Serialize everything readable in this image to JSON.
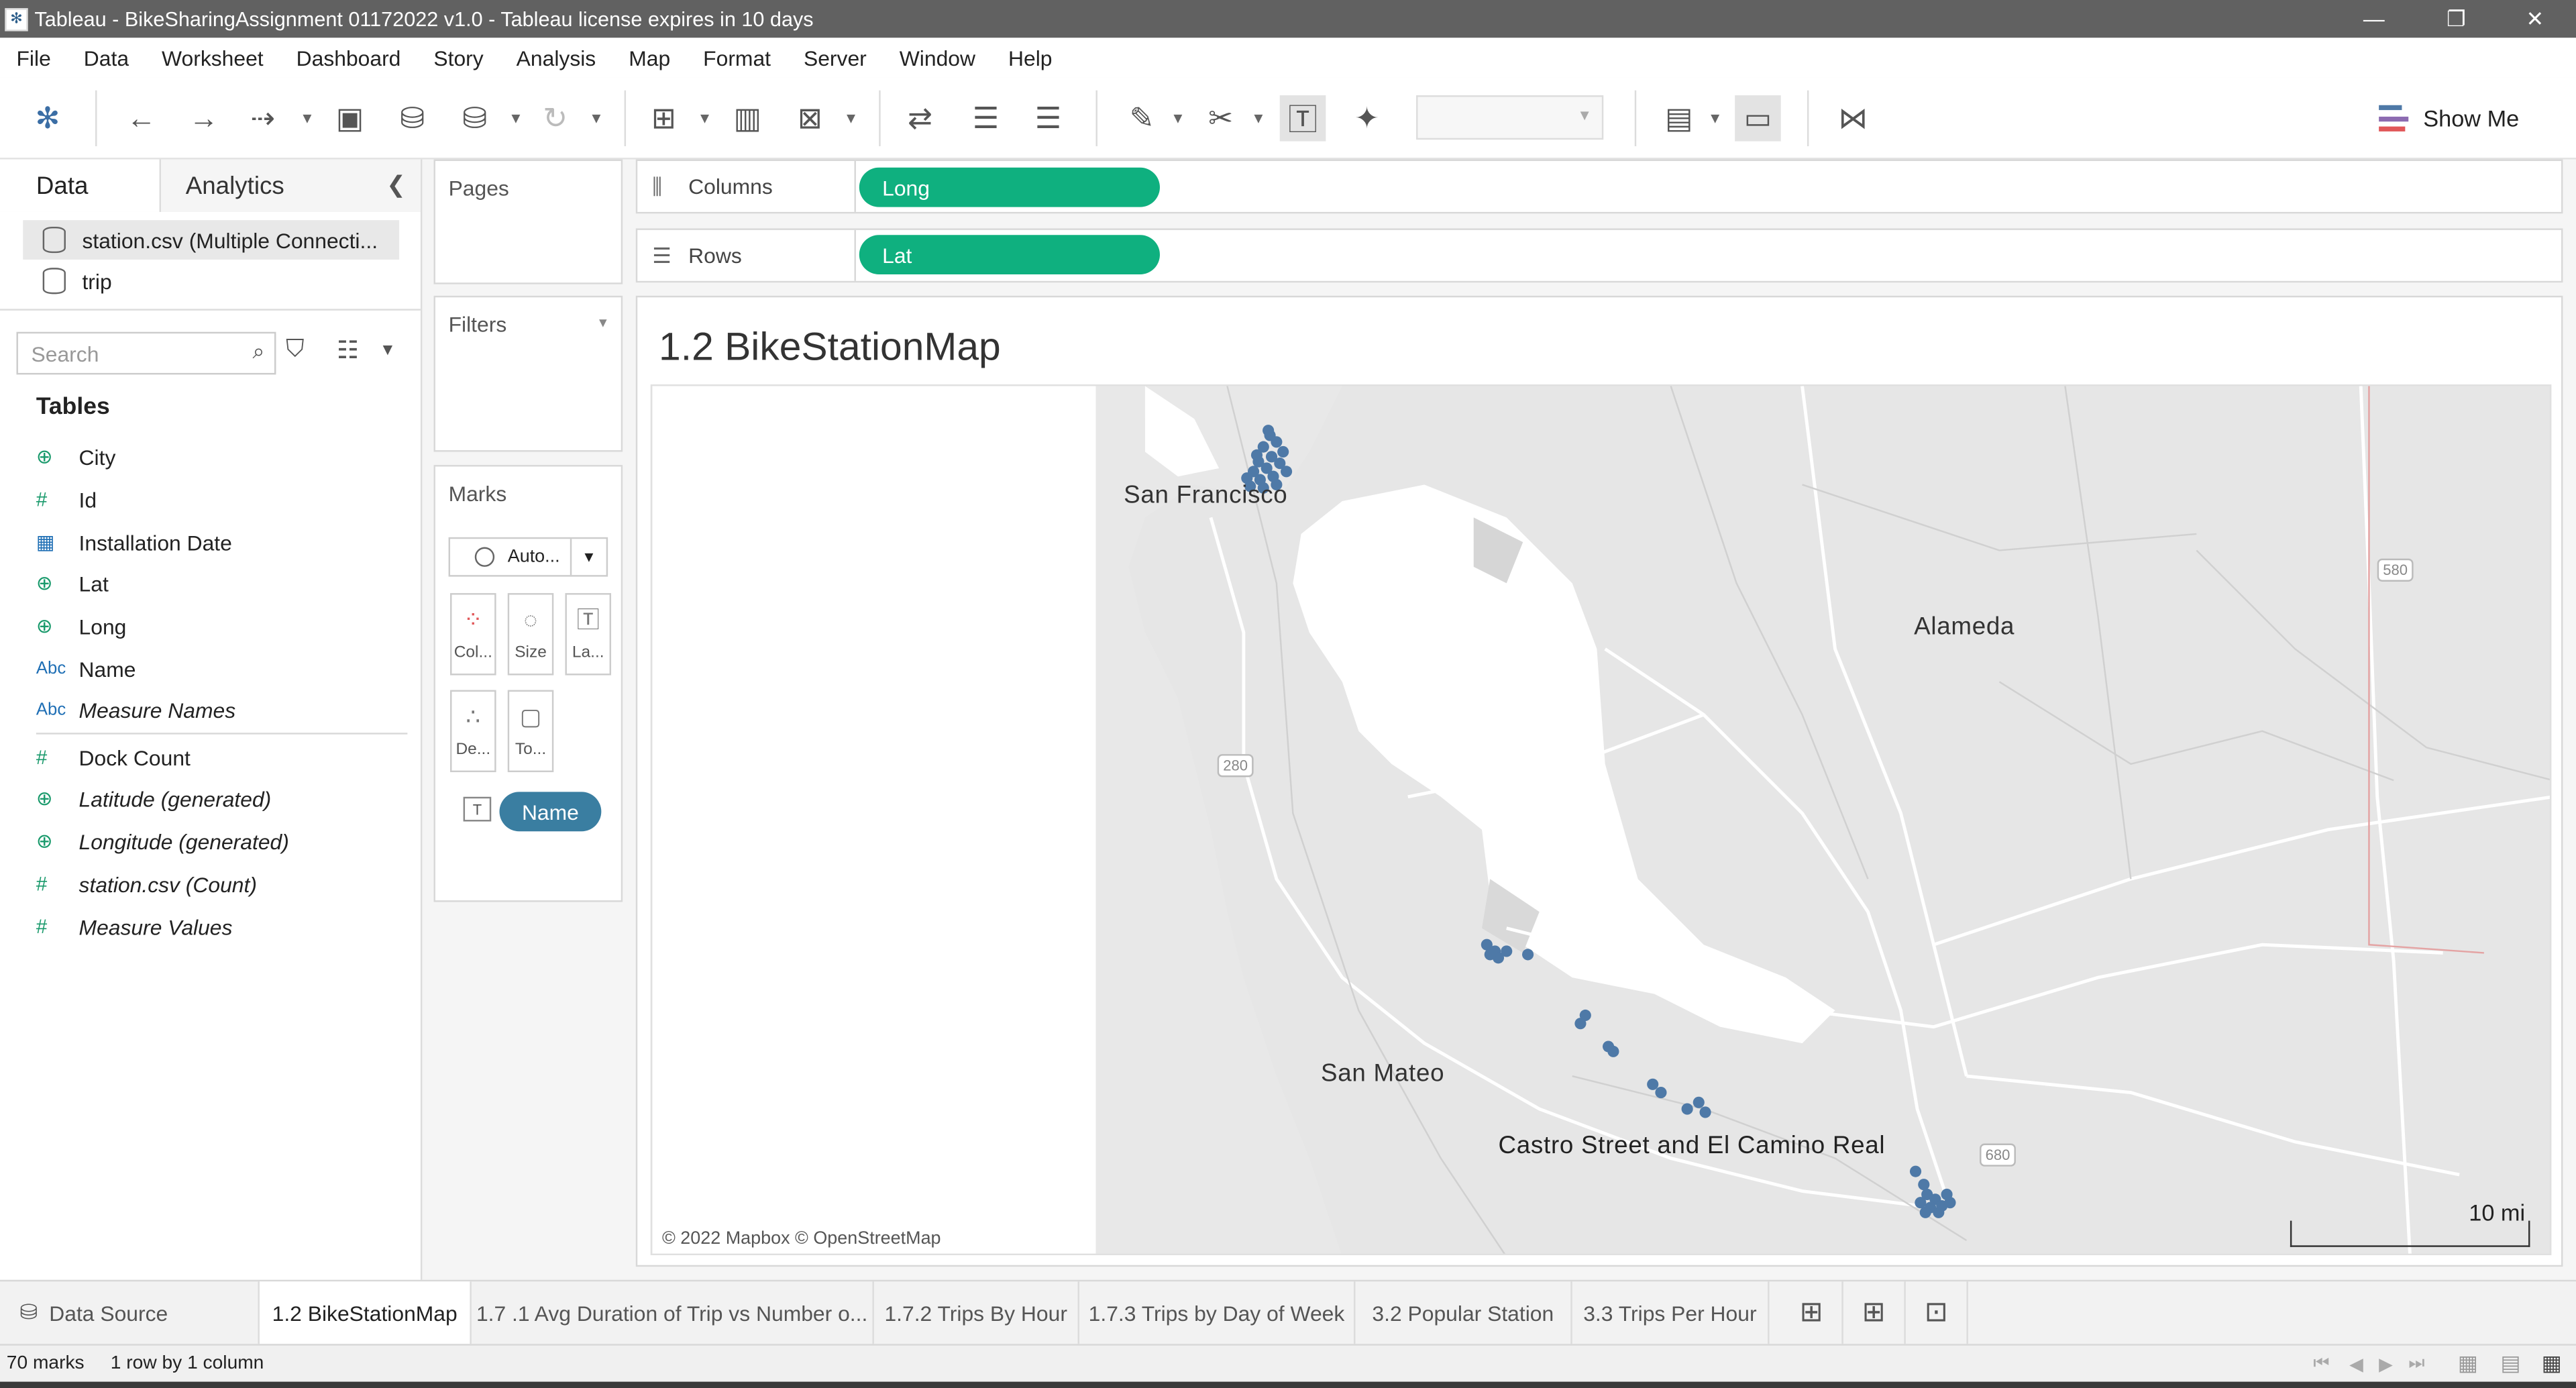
{
  "window": {
    "title": "Tableau - BikeSharingAssignment 01172022 v1.0 - Tableau license expires in 10 days",
    "controls": [
      "minimize",
      "restore",
      "close"
    ]
  },
  "menu": [
    "File",
    "Data",
    "Worksheet",
    "Dashboard",
    "Story",
    "Analysis",
    "Map",
    "Format",
    "Server",
    "Window",
    "Help"
  ],
  "toolbar": {
    "show_me": "Show Me"
  },
  "data_pane": {
    "tabs": [
      "Data",
      "Analytics"
    ],
    "connections": [
      "station.csv (Multiple Connecti...",
      "trip"
    ],
    "search_placeholder": "Search",
    "tables_heading": "Tables",
    "fields": [
      {
        "icon": "globe",
        "name": "City",
        "italic": false
      },
      {
        "icon": "#",
        "name": "Id",
        "italic": false
      },
      {
        "icon": "calendar",
        "name": "Installation Date",
        "italic": false
      },
      {
        "icon": "globe",
        "name": "Lat",
        "italic": false
      },
      {
        "icon": "globe",
        "name": "Long",
        "italic": false
      },
      {
        "icon": "Abc",
        "name": "Name",
        "italic": false
      },
      {
        "icon": "Abc",
        "name": "Measure Names",
        "italic": true
      },
      {
        "icon": "#",
        "name": "Dock Count",
        "italic": false
      },
      {
        "icon": "globe",
        "name": "Latitude (generated)",
        "italic": true
      },
      {
        "icon": "globe",
        "name": "Longitude (generated)",
        "italic": true
      },
      {
        "icon": "#",
        "name": "station.csv (Count)",
        "italic": true
      },
      {
        "icon": "#",
        "name": "Measure Values",
        "italic": true
      }
    ]
  },
  "cards": {
    "pages": "Pages",
    "filters": "Filters",
    "marks": {
      "title": "Marks",
      "type": "Auto...",
      "buttons": [
        "Col...",
        "Size",
        "La...",
        "De...",
        "To..."
      ],
      "pill": "Name"
    }
  },
  "shelves": {
    "columns_label": "Columns",
    "columns_pill": "Long",
    "rows_label": "Rows",
    "rows_pill": "Lat"
  },
  "view": {
    "title": "1.2 BikeStationMap",
    "map_labels": {
      "sf": "San Francisco",
      "alameda": "Alameda",
      "san_mateo": "San Mateo",
      "castro": "Castro Street and El Camino Real"
    },
    "shields": [
      "580",
      "280",
      "680"
    ],
    "credit": "© 2022 Mapbox © OpenStreetMap",
    "scale": "10 mi"
  },
  "sheet_tabs": [
    "Data Source",
    "1.2 BikeStationMap",
    "1.7 .1 Avg Duration of Trip  vs Number o...",
    "1.7.2 Trips By Hour",
    "1.7.3 Trips by Day of Week",
    "3.2  Popular Station",
    "3.3 Trips Per Hour"
  ],
  "status": {
    "marks": "70 marks",
    "layout": "1 row by 1 column"
  },
  "colors": {
    "pill_green": "#0fb07f",
    "pill_blue": "#3a7ea1",
    "mark_blue": "#4e79a7",
    "title_bar": "#616161"
  }
}
